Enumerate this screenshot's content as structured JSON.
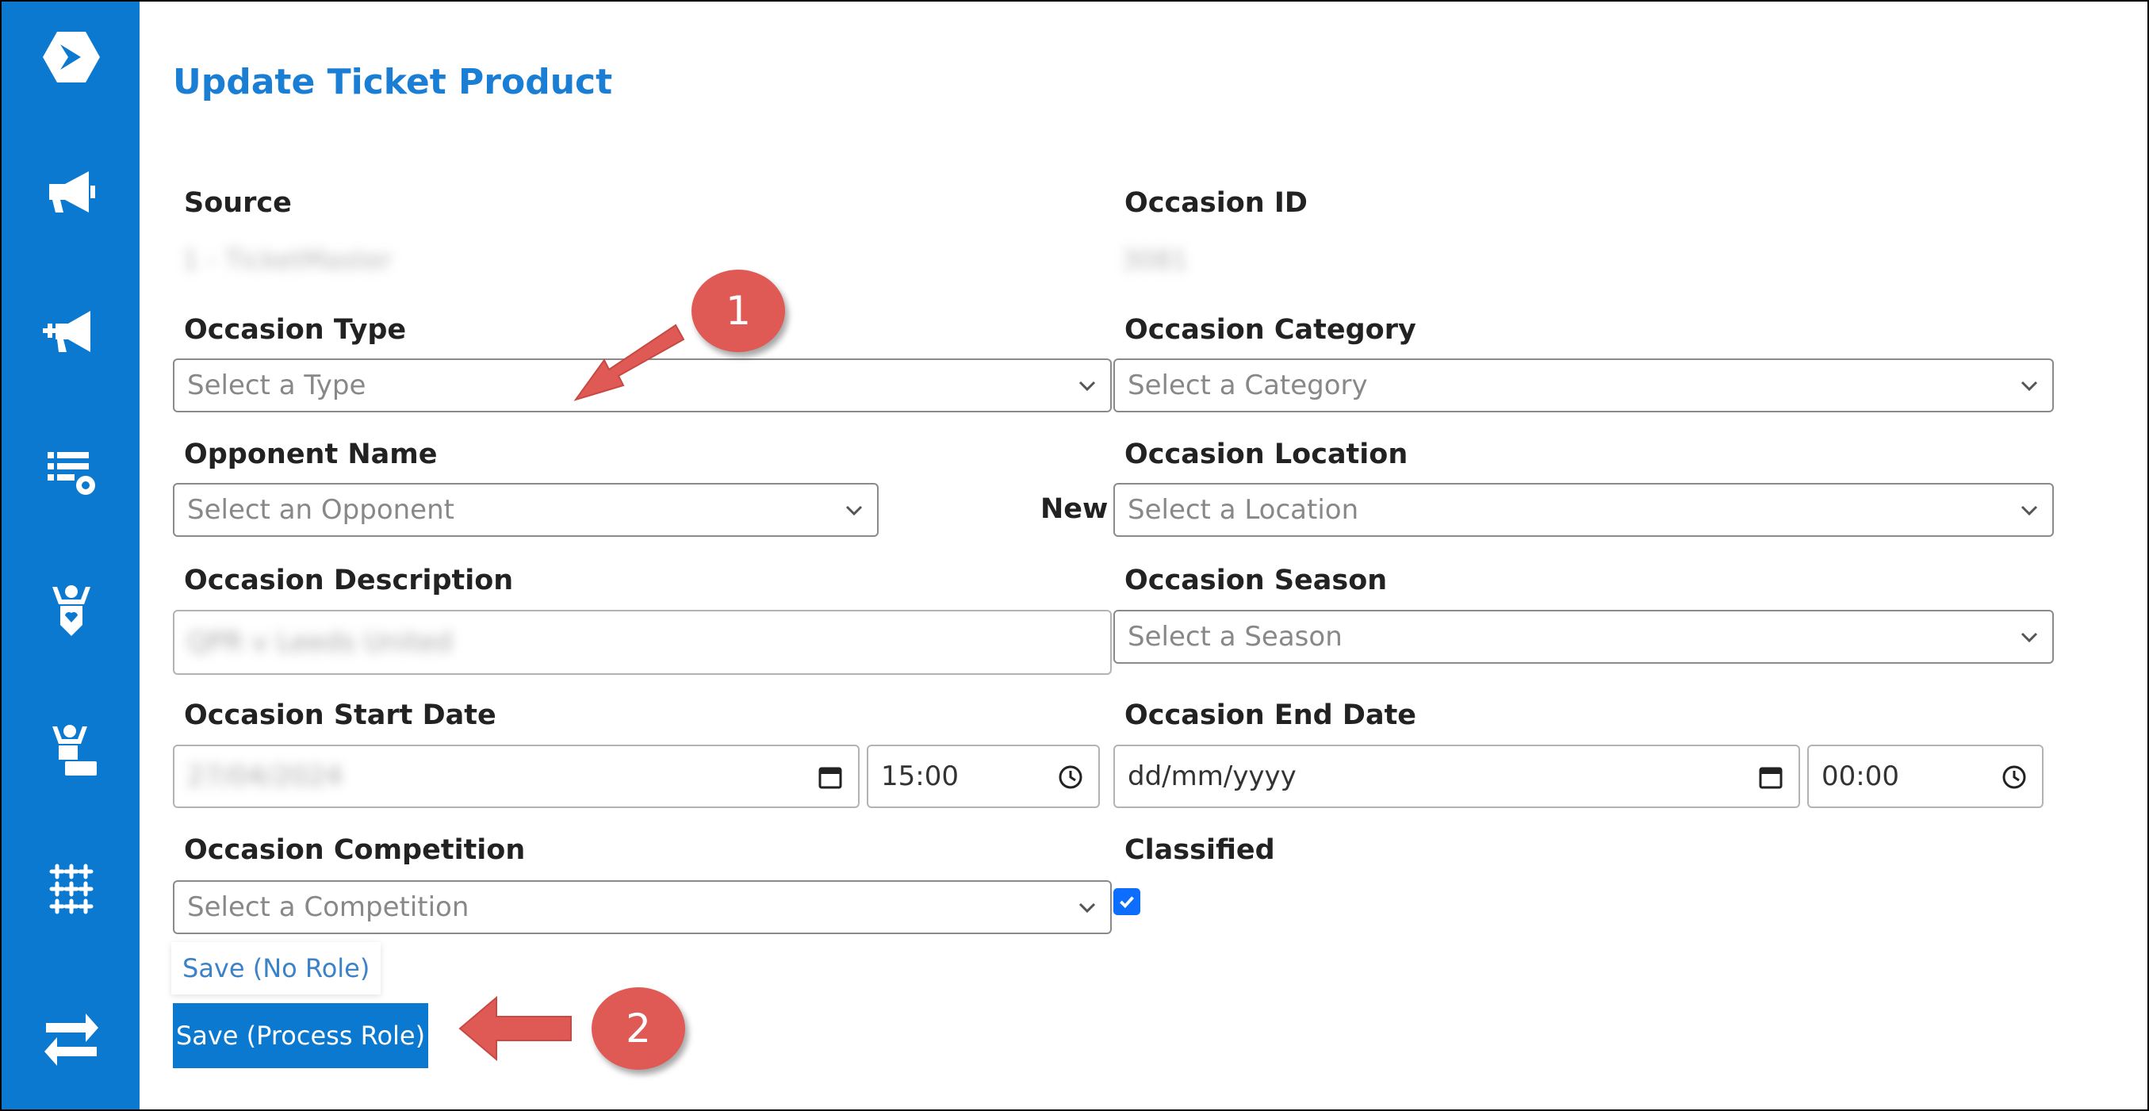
{
  "form": {
    "title": "Update Ticket Product",
    "source": {
      "label": "Source",
      "value": "1 - TicketMaster"
    },
    "occasion_id": {
      "label": "Occasion ID",
      "value": "3081"
    },
    "occasion_type": {
      "label": "Occasion Type",
      "placeholder": "Select a Type"
    },
    "occasion_category": {
      "label": "Occasion Category",
      "placeholder": "Select a Category"
    },
    "opponent_name": {
      "label": "Opponent Name",
      "placeholder": "Select an Opponent"
    },
    "new_label": "New",
    "occasion_location": {
      "label": "Occasion Location",
      "placeholder": "Select a Location"
    },
    "occasion_description": {
      "label": "Occasion Description",
      "value": "QPR v Leeds United"
    },
    "occasion_season": {
      "label": "Occasion Season",
      "placeholder": "Select a Season"
    },
    "start_date": {
      "label": "Occasion Start Date",
      "date_value": "27/04/2024",
      "time_value": "15:00"
    },
    "end_date": {
      "label": "Occasion End Date",
      "date_value": "dd/mm/yyyy",
      "time_value": "00:00"
    },
    "occasion_competition": {
      "label": "Occasion Competition",
      "placeholder": "Select a Competition"
    },
    "classified": {
      "label": "Classified",
      "checked": true
    },
    "buttons": {
      "save_no_role": "Save (No Role)",
      "save_process_role": "Save (Process Role)"
    }
  },
  "callouts": {
    "first": "1",
    "second": "2"
  },
  "sidebar": {
    "items": [
      {
        "icon": "logo-icon"
      },
      {
        "icon": "megaphone-icon"
      },
      {
        "icon": "megaphone-plus-icon"
      },
      {
        "icon": "list-settings-icon"
      },
      {
        "icon": "person-heart-icon"
      },
      {
        "icon": "person-desk-icon"
      },
      {
        "icon": "sparkle-grid-icon"
      },
      {
        "icon": "swap-arrows-icon"
      }
    ]
  },
  "colors": {
    "sidebar": "#0b79d0",
    "title": "#1a7fd4",
    "callout": "#e05a55",
    "checkbox": "#0d6efd"
  }
}
